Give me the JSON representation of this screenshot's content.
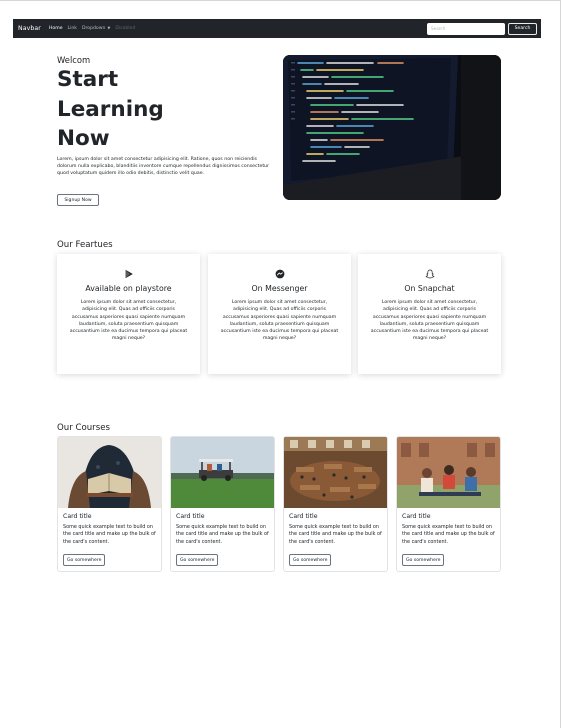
{
  "navbar": {
    "brand": "Navbar",
    "links": [
      "Home",
      "Link",
      "Dropdown",
      "Disabled"
    ],
    "search_placeholder": "Search",
    "search_button": "Search"
  },
  "hero": {
    "eyebrow": "Welcom",
    "title": "Start Learning Now",
    "text": "Lorem, ipsum dolor sit amet consectetur adipisicing elit. Ratione, quos non reiciendis dolorum nulla explicabo, blanditiis inventore cumque repellendus dignissimos consectetur quod voluptatum quidem illo odio debitis, distinctio velit quae.",
    "button": "Signup Now"
  },
  "features": {
    "title": "Our Feartues",
    "cards": [
      {
        "icon": "playstore-icon",
        "title": "Available on playstore",
        "text": "Lorem ipsum dolor sit amet consectetur, adipisicing elit. Quas ad officiis corporis accusamus asperiores quasi sapiente numquam laudantium, soluta praesentium quisquam accusantium iste ea ducimus tempora qui placeat magni neque?"
      },
      {
        "icon": "messenger-icon",
        "title": "On Messenger",
        "text": "Lorem ipsum dolor sit amet consectetur, adipisicing elit. Quas ad officiis corporis accusamus asperiores quasi sapiente numquam laudantium, soluta praesentium quisquam accusantium iste ea ducimus tempora qui placeat magni neque?"
      },
      {
        "icon": "snapchat-icon",
        "title": "On Snapchat",
        "text": "Lorem ipsum dolor sit amet consectetur, adipisicing elit. Quas ad officiis corporis accusamus asperiores quasi sapiente numquam laudantium, soluta praesentium quisquam accusantium iste ea ducimus tempora qui placeat magni neque?"
      }
    ]
  },
  "courses": {
    "title": "Our Courses",
    "cards": [
      {
        "title": "Card title",
        "text": "Some quick example text to build on the card title and make up the bulk of the card's content.",
        "button": "Go somewhere"
      },
      {
        "title": "Card title",
        "text": "Some quick example text to build on the card title and make up the bulk of the card's content.",
        "button": "Go somewhere"
      },
      {
        "title": "Card title",
        "text": "Some quick example text to build on the card title and make up the bulk of the card's content.",
        "button": "Go somewhere"
      },
      {
        "title": "Card title",
        "text": "Some quick example text to build on the card title and make up the bulk of the card's content.",
        "button": "Go somewhere"
      }
    ]
  }
}
